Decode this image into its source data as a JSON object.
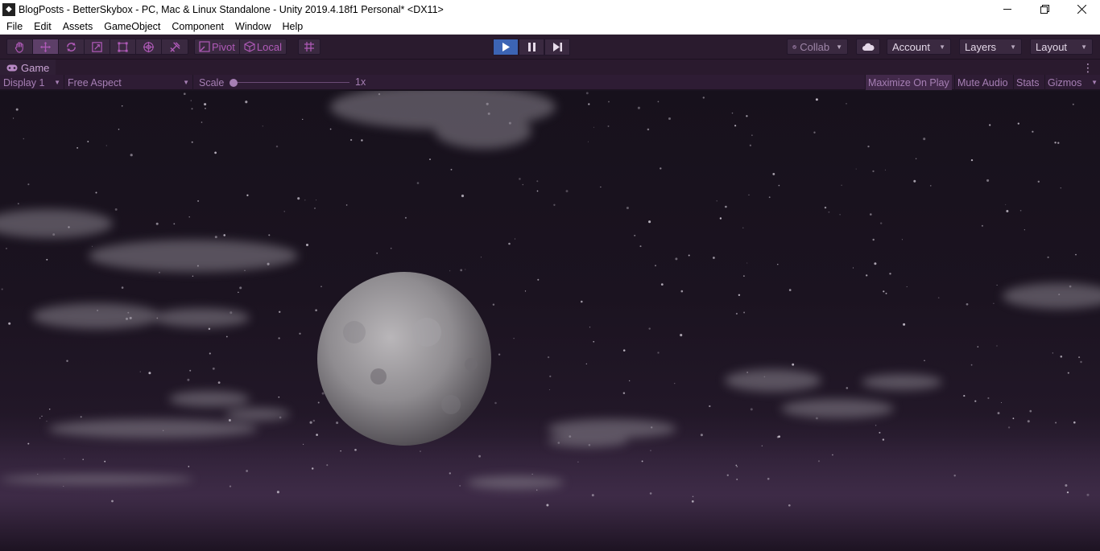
{
  "window": {
    "title": "BlogPosts - BetterSkybox - PC, Mac & Linux Standalone - Unity 2019.4.18f1 Personal* <DX11>",
    "minimize_icon": "minimize-icon",
    "maximize_icon": "restore-icon",
    "close_icon": "close-icon"
  },
  "menu": {
    "items": [
      "File",
      "Edit",
      "Assets",
      "GameObject",
      "Component",
      "Window",
      "Help"
    ]
  },
  "toolbar": {
    "tools": [
      "hand-tool",
      "move-tool",
      "rotate-tool",
      "scale-tool",
      "rect-tool",
      "transform-tool",
      "custom-tool"
    ],
    "active_tool": "move-tool",
    "pivot_label": "Pivot",
    "local_label": "Local",
    "collab_label": "Collab",
    "account_label": "Account",
    "layers_label": "Layers",
    "layout_label": "Layout",
    "accent_color": "#b05ab8",
    "play_active_color": "#3c64b4"
  },
  "game_tab": {
    "label": "Game",
    "display_value": "Display 1",
    "aspect_value": "Free Aspect",
    "scale_label": "Scale",
    "scale_value": "1x",
    "maximize_label": "Maximize On Play",
    "mute_label": "Mute Audio",
    "stats_label": "Stats",
    "gizmos_label": "Gizmos"
  }
}
